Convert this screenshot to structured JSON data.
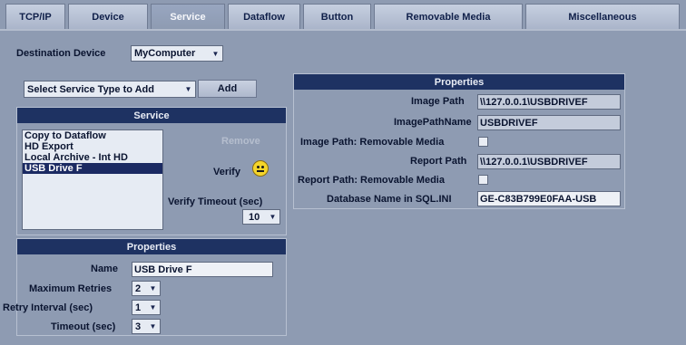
{
  "tabs": [
    {
      "label": "TCP/IP"
    },
    {
      "label": "Device"
    },
    {
      "label": "Service"
    },
    {
      "label": "Dataflow"
    },
    {
      "label": "Button"
    },
    {
      "label": "Removable Media"
    },
    {
      "label": "Miscellaneous"
    }
  ],
  "active_tab": "Service",
  "destination": {
    "label": "Destination Device",
    "value": "MyComputer"
  },
  "service_type": {
    "value": "Select Service Type to Add",
    "add_label": "Add"
  },
  "service_panel": {
    "title": "Service",
    "items": [
      "Copy to Dataflow",
      "HD Export",
      "Local Archive - Int HD",
      "USB Drive F"
    ],
    "selected": "USB Drive F",
    "remove_label": "Remove",
    "verify_label": "Verify",
    "verify_icon": "smiley-icon",
    "timeout_label": "Verify Timeout (sec)",
    "timeout_value": "10"
  },
  "properties_left": {
    "title": "Properties",
    "name_label": "Name",
    "name_value": "USB Drive F",
    "retries_label": "Maximum Retries",
    "retries_value": "2",
    "retry_interval_label": "Retry Interval (sec)",
    "retry_interval_value": "1",
    "timeout_label": "Timeout (sec)",
    "timeout_value": "3"
  },
  "properties_right": {
    "title": "Properties",
    "image_path_label": "Image Path",
    "image_path_value": "\\\\127.0.0.1\\USBDRIVEF",
    "image_path_name_label": "ImagePathName",
    "image_path_name_value": "USBDRIVEF",
    "image_removable_label": "Image Path: Removable Media",
    "report_path_label": "Report Path",
    "report_path_value": "\\\\127.0.0.1\\USBDRIVEF",
    "report_removable_label": "Report Path: Removable Media",
    "db_name_label": "Database Name in SQL.INI",
    "db_name_value": "GE-C83B799E0FAA-USB"
  },
  "colors": {
    "background": "#8e9bb2",
    "header": "#1e3262",
    "selected": "#1b2a62"
  }
}
